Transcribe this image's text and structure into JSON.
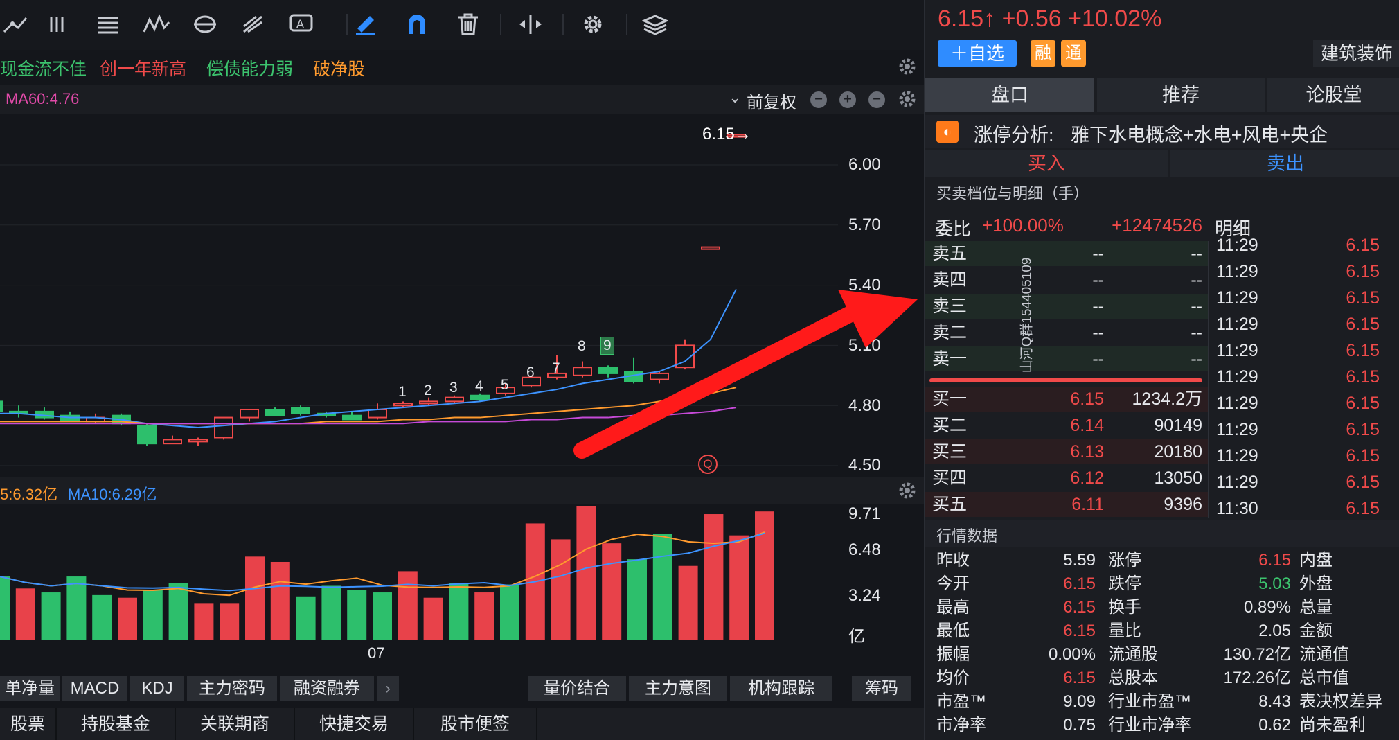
{
  "toolbar": {
    "icons": [
      "line-tool-icon",
      "bars-tool-icon",
      "text-lines-icon",
      "wave-tool-icon",
      "cycle-tool-icon",
      "fork-tool-icon",
      "text-box-icon",
      "pen-icon",
      "magnet-icon",
      "trash-icon",
      "split-icon",
      "gear-icon",
      "layers-icon"
    ]
  },
  "tags": [
    {
      "label": "现金流不佳",
      "color": "#3cc46e"
    },
    {
      "label": "创一年新高",
      "color": "#f04a4a"
    },
    {
      "label": "偿债能力弱",
      "color": "#3cc46e"
    },
    {
      "label": "破净股",
      "color": "#ff9a2e"
    }
  ],
  "ma_bar": {
    "ma60": "MA60:4.76",
    "adjust": "前复权"
  },
  "price_axis": [
    "6.00",
    "5.70",
    "5.40",
    "5.10",
    "4.80",
    "4.50"
  ],
  "last_price_label": "6.15→",
  "count_labels": [
    "1",
    "2",
    "3",
    "4",
    "5",
    "6",
    "7",
    "8",
    "9"
  ],
  "q_marker": "Q",
  "watermark": "山河Q群154405109",
  "volume_bar": {
    "ma5": "5:6.32亿",
    "ma10": "MA10:6.29亿"
  },
  "volume_axis": [
    "9.71",
    "6.48",
    "3.24",
    "亿"
  ],
  "x_axis_label": "07",
  "indicator_tabs": [
    "单净量",
    "MACD",
    "KDJ",
    "主力密码",
    "融资融券"
  ],
  "indicator_tabs_right": [
    "量价结合",
    "主力意图",
    "机构跟踪"
  ],
  "chip_tab": "筹码",
  "bottom_bar": [
    "股票",
    "持股基金",
    "关联期商",
    "快捷交易",
    "股市便签"
  ],
  "header": {
    "price": "6.15↑",
    "change": "+0.56",
    "pct": "+10.02%",
    "add_watch": "＋自选",
    "margin_badge": "融",
    "connect_badge": "通",
    "industry": "建筑装饰"
  },
  "tabs": [
    "盘口",
    "推荐",
    "论股堂"
  ],
  "limit_up": {
    "label": "涨停分析:",
    "text": "雅下水电概念+水电+风电+央企"
  },
  "trade": {
    "buy": "买入",
    "sell": "卖出"
  },
  "order_book_title": "买卖档位与明细（手）",
  "weibi": {
    "label": "委比",
    "pct": "+100.00%",
    "diff": "+12474526"
  },
  "detail_title": "明细",
  "asks": [
    {
      "label": "卖五",
      "price": "--",
      "vol": "--"
    },
    {
      "label": "卖四",
      "price": "--",
      "vol": "--"
    },
    {
      "label": "卖三",
      "price": "--",
      "vol": "--"
    },
    {
      "label": "卖二",
      "price": "--",
      "vol": "--"
    },
    {
      "label": "卖一",
      "price": "--",
      "vol": "--"
    }
  ],
  "bids": [
    {
      "label": "买一",
      "price": "6.15",
      "vol": "1234.2万"
    },
    {
      "label": "买二",
      "price": "6.14",
      "vol": "90149"
    },
    {
      "label": "买三",
      "price": "6.13",
      "vol": "20180"
    },
    {
      "label": "买四",
      "price": "6.12",
      "vol": "13050"
    },
    {
      "label": "买五",
      "price": "6.11",
      "vol": "9396"
    }
  ],
  "details": [
    {
      "time": "11:29",
      "price": "6.15"
    },
    {
      "time": "11:29",
      "price": "6.15"
    },
    {
      "time": "11:29",
      "price": "6.15"
    },
    {
      "time": "11:29",
      "price": "6.15"
    },
    {
      "time": "11:29",
      "price": "6.15"
    },
    {
      "time": "11:29",
      "price": "6.15"
    },
    {
      "time": "11:29",
      "price": "6.15"
    },
    {
      "time": "11:29",
      "price": "6.15"
    },
    {
      "time": "11:29",
      "price": "6.15"
    },
    {
      "time": "11:29",
      "price": "6.15"
    },
    {
      "time": "11:30",
      "price": "6.15"
    }
  ],
  "quote_title": "行情数据",
  "quotes": [
    [
      {
        "k": "昨收",
        "v": "5.59",
        "c": "#e6e8ec"
      },
      {
        "k": "涨停",
        "v": "6.15",
        "c": "#f04a4a"
      },
      {
        "k": "内盘",
        "v": "",
        "c": "#e6e8ec"
      }
    ],
    [
      {
        "k": "今开",
        "v": "6.15",
        "c": "#f04a4a"
      },
      {
        "k": "跌停",
        "v": "5.03",
        "c": "#3cc46e"
      },
      {
        "k": "外盘",
        "v": "",
        "c": "#e6e8ec"
      }
    ],
    [
      {
        "k": "最高",
        "v": "6.15",
        "c": "#f04a4a"
      },
      {
        "k": "换手",
        "v": "0.89%",
        "c": "#e6e8ec"
      },
      {
        "k": "总量",
        "v": "",
        "c": "#e6e8ec"
      }
    ],
    [
      {
        "k": "最低",
        "v": "6.15",
        "c": "#f04a4a"
      },
      {
        "k": "量比",
        "v": "2.05",
        "c": "#e6e8ec"
      },
      {
        "k": "金额",
        "v": "",
        "c": "#e6e8ec"
      }
    ],
    [
      {
        "k": "振幅",
        "v": "0.00%",
        "c": "#e6e8ec"
      },
      {
        "k": "流通股",
        "v": "130.72亿",
        "c": "#e6e8ec"
      },
      {
        "k": "流通值",
        "v": "",
        "c": "#e6e8ec"
      }
    ],
    [
      {
        "k": "均价",
        "v": "6.15",
        "c": "#f04a4a"
      },
      {
        "k": "总股本",
        "v": "172.26亿",
        "c": "#e6e8ec"
      },
      {
        "k": "总市值",
        "v": "",
        "c": "#e6e8ec"
      }
    ],
    [
      {
        "k": "市盈™",
        "v": "9.09",
        "c": "#e6e8ec"
      },
      {
        "k": "行业市盈™",
        "v": "8.43",
        "c": "#e6e8ec"
      },
      {
        "k": "表决权差异",
        "v": "",
        "c": "#e6e8ec"
      }
    ],
    [
      {
        "k": "市净率",
        "v": "0.75",
        "c": "#e6e8ec"
      },
      {
        "k": "行业市净率",
        "v": "0.62",
        "c": "#e6e8ec"
      },
      {
        "k": "尚未盈利",
        "v": "",
        "c": "#e6e8ec"
      }
    ]
  ],
  "chart_data": {
    "type": "candlestick",
    "ylim": [
      4.5,
      6.0
    ],
    "candles": [
      {
        "o": 4.82,
        "c": 4.77,
        "h": 4.82,
        "l": 4.76
      },
      {
        "o": 4.77,
        "c": 4.76,
        "h": 4.8,
        "l": 4.74
      },
      {
        "o": 4.77,
        "c": 4.74,
        "h": 4.79,
        "l": 4.73
      },
      {
        "o": 4.75,
        "c": 4.72,
        "h": 4.77,
        "l": 4.72
      },
      {
        "o": 4.72,
        "c": 4.74,
        "h": 4.76,
        "l": 4.71
      },
      {
        "o": 4.75,
        "c": 4.71,
        "h": 4.76,
        "l": 4.7
      },
      {
        "o": 4.7,
        "c": 4.61,
        "h": 4.71,
        "l": 4.6
      },
      {
        "o": 4.61,
        "c": 4.63,
        "h": 4.65,
        "l": 4.61
      },
      {
        "o": 4.62,
        "c": 4.63,
        "h": 4.64,
        "l": 4.6
      },
      {
        "o": 4.64,
        "c": 4.74,
        "h": 4.74,
        "l": 4.63
      },
      {
        "o": 4.74,
        "c": 4.78,
        "h": 4.78,
        "l": 4.72
      },
      {
        "o": 4.78,
        "c": 4.75,
        "h": 4.79,
        "l": 4.75
      },
      {
        "o": 4.79,
        "c": 4.76,
        "h": 4.8,
        "l": 4.75
      },
      {
        "o": 4.76,
        "c": 4.75,
        "h": 4.77,
        "l": 4.74
      },
      {
        "o": 4.75,
        "c": 4.73,
        "h": 4.77,
        "l": 4.73
      },
      {
        "o": 4.74,
        "c": 4.78,
        "h": 4.81,
        "l": 4.73
      },
      {
        "o": 4.8,
        "c": 4.81,
        "h": 4.82,
        "l": 4.79
      },
      {
        "o": 4.81,
        "c": 4.82,
        "h": 4.84,
        "l": 4.8
      },
      {
        "o": 4.82,
        "c": 4.84,
        "h": 4.85,
        "l": 4.81
      },
      {
        "o": 4.85,
        "c": 4.83,
        "h": 4.86,
        "l": 4.82
      },
      {
        "o": 4.86,
        "c": 4.89,
        "h": 4.91,
        "l": 4.85
      },
      {
        "o": 4.9,
        "c": 4.94,
        "h": 4.95,
        "l": 4.89
      },
      {
        "o": 4.94,
        "c": 4.96,
        "h": 5.05,
        "l": 4.93
      },
      {
        "o": 4.95,
        "c": 4.99,
        "h": 5.02,
        "l": 4.94
      },
      {
        "o": 4.99,
        "c": 4.96,
        "h": 5.0,
        "l": 4.94
      },
      {
        "o": 4.97,
        "c": 4.92,
        "h": 5.04,
        "l": 4.91
      },
      {
        "o": 4.93,
        "c": 4.96,
        "h": 4.97,
        "l": 4.91
      },
      {
        "o": 4.99,
        "c": 5.1,
        "h": 5.13,
        "l": 4.98
      },
      {
        "o": 5.59,
        "c": 5.59,
        "h": 5.59,
        "l": 5.59
      },
      {
        "o": 6.15,
        "c": 6.15,
        "h": 6.15,
        "l": 6.15
      }
    ],
    "ma5": [
      4.76,
      4.76,
      4.75,
      4.74,
      4.74,
      4.73,
      4.71,
      4.7,
      4.69,
      4.7,
      4.71,
      4.72,
      4.74,
      4.76,
      4.77,
      4.78,
      4.79,
      4.8,
      4.81,
      4.82,
      4.84,
      4.86,
      4.88,
      4.91,
      4.93,
      4.95,
      4.97,
      5.02,
      5.13,
      5.38
    ],
    "ma10": [
      4.72,
      4.72,
      4.72,
      4.72,
      4.72,
      4.72,
      4.71,
      4.71,
      4.71,
      4.71,
      4.71,
      4.71,
      4.71,
      4.72,
      4.72,
      4.72,
      4.73,
      4.73,
      4.74,
      4.74,
      4.75,
      4.76,
      4.77,
      4.78,
      4.79,
      4.8,
      4.82,
      4.84,
      4.86,
      4.89
    ],
    "ma20": [
      4.71,
      4.71,
      4.71,
      4.71,
      4.71,
      4.71,
      4.71,
      4.71,
      4.71,
      4.71,
      4.71,
      4.71,
      4.71,
      4.71,
      4.71,
      4.71,
      4.71,
      4.72,
      4.72,
      4.72,
      4.72,
      4.73,
      4.73,
      4.74,
      4.74,
      4.75,
      4.75,
      4.76,
      4.77,
      4.79
    ],
    "volumes": [
      {
        "v": 4.8,
        "up": false
      },
      {
        "v": 3.9,
        "up": true
      },
      {
        "v": 3.6,
        "up": false
      },
      {
        "v": 4.8,
        "up": false
      },
      {
        "v": 3.4,
        "up": false
      },
      {
        "v": 3.2,
        "up": true
      },
      {
        "v": 3.8,
        "up": false
      },
      {
        "v": 4.3,
        "up": false
      },
      {
        "v": 2.8,
        "up": true
      },
      {
        "v": 2.8,
        "up": true
      },
      {
        "v": 6.3,
        "up": true
      },
      {
        "v": 5.9,
        "up": true
      },
      {
        "v": 3.3,
        "up": false
      },
      {
        "v": 4.1,
        "up": false
      },
      {
        "v": 3.8,
        "up": false
      },
      {
        "v": 3.6,
        "up": false
      },
      {
        "v": 5.2,
        "up": true
      },
      {
        "v": 3.2,
        "up": true
      },
      {
        "v": 4.3,
        "up": false
      },
      {
        "v": 3.6,
        "up": true
      },
      {
        "v": 4.2,
        "up": false
      },
      {
        "v": 8.8,
        "up": true
      },
      {
        "v": 7.6,
        "up": true
      },
      {
        "v": 10.1,
        "up": true
      },
      {
        "v": 7.3,
        "up": true
      },
      {
        "v": 6.1,
        "up": false
      },
      {
        "v": 8.0,
        "up": false
      },
      {
        "v": 5.6,
        "up": true
      },
      {
        "v": 9.5,
        "up": true
      },
      {
        "v": 7.9,
        "up": true
      },
      {
        "v": 9.7,
        "up": true
      }
    ],
    "vol_ylim": [
      0,
      9.71
    ]
  }
}
